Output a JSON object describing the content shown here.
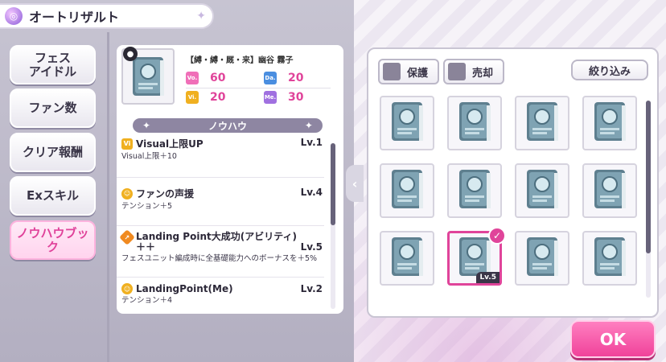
{
  "title": "オートリザルト",
  "sidebar": {
    "items": [
      {
        "label": "フェス\nアイドル"
      },
      {
        "label": "ファン数"
      },
      {
        "label": "クリア報酬"
      },
      {
        "label": "Exスキル"
      },
      {
        "label": "ノウハウブック"
      }
    ]
  },
  "idol": {
    "name": "【縛・縛・厩・来】幽谷 霧子",
    "stats": {
      "vo": {
        "tag": "Vo.",
        "value": "60"
      },
      "da": {
        "tag": "Da.",
        "value": "20"
      },
      "vi": {
        "tag": "Vi.",
        "value": "20"
      },
      "me": {
        "tag": "Me.",
        "value": "30"
      }
    }
  },
  "knowhow": {
    "header": "ノウハウ",
    "items": [
      {
        "name": "Visual上限UP",
        "level": "Lv.1",
        "desc": "Visual上限＋10"
      },
      {
        "name": "ファンの声援",
        "level": "Lv.4",
        "desc": "テンション＋5"
      },
      {
        "name": "Landing Point大成功(アビリティ)＋＋",
        "level": "Lv.5",
        "desc": "フェスユニット編成時に全基礎能力へのボーナスを＋5%"
      },
      {
        "name": "LandingPoint(Me)",
        "level": "Lv.2",
        "desc": "テンション＋4"
      }
    ]
  },
  "right": {
    "protect_label": "保護",
    "sell_label": "売却",
    "filter_label": "絞り込み",
    "selected_level": "Lv.5",
    "selected_mark": "✓"
  },
  "ok_label": "OK",
  "colors": {
    "accent": "#e0449a",
    "vo": "#f06fb8",
    "da": "#4a8ee0",
    "vi": "#f0b020",
    "me": "#a070e0"
  }
}
